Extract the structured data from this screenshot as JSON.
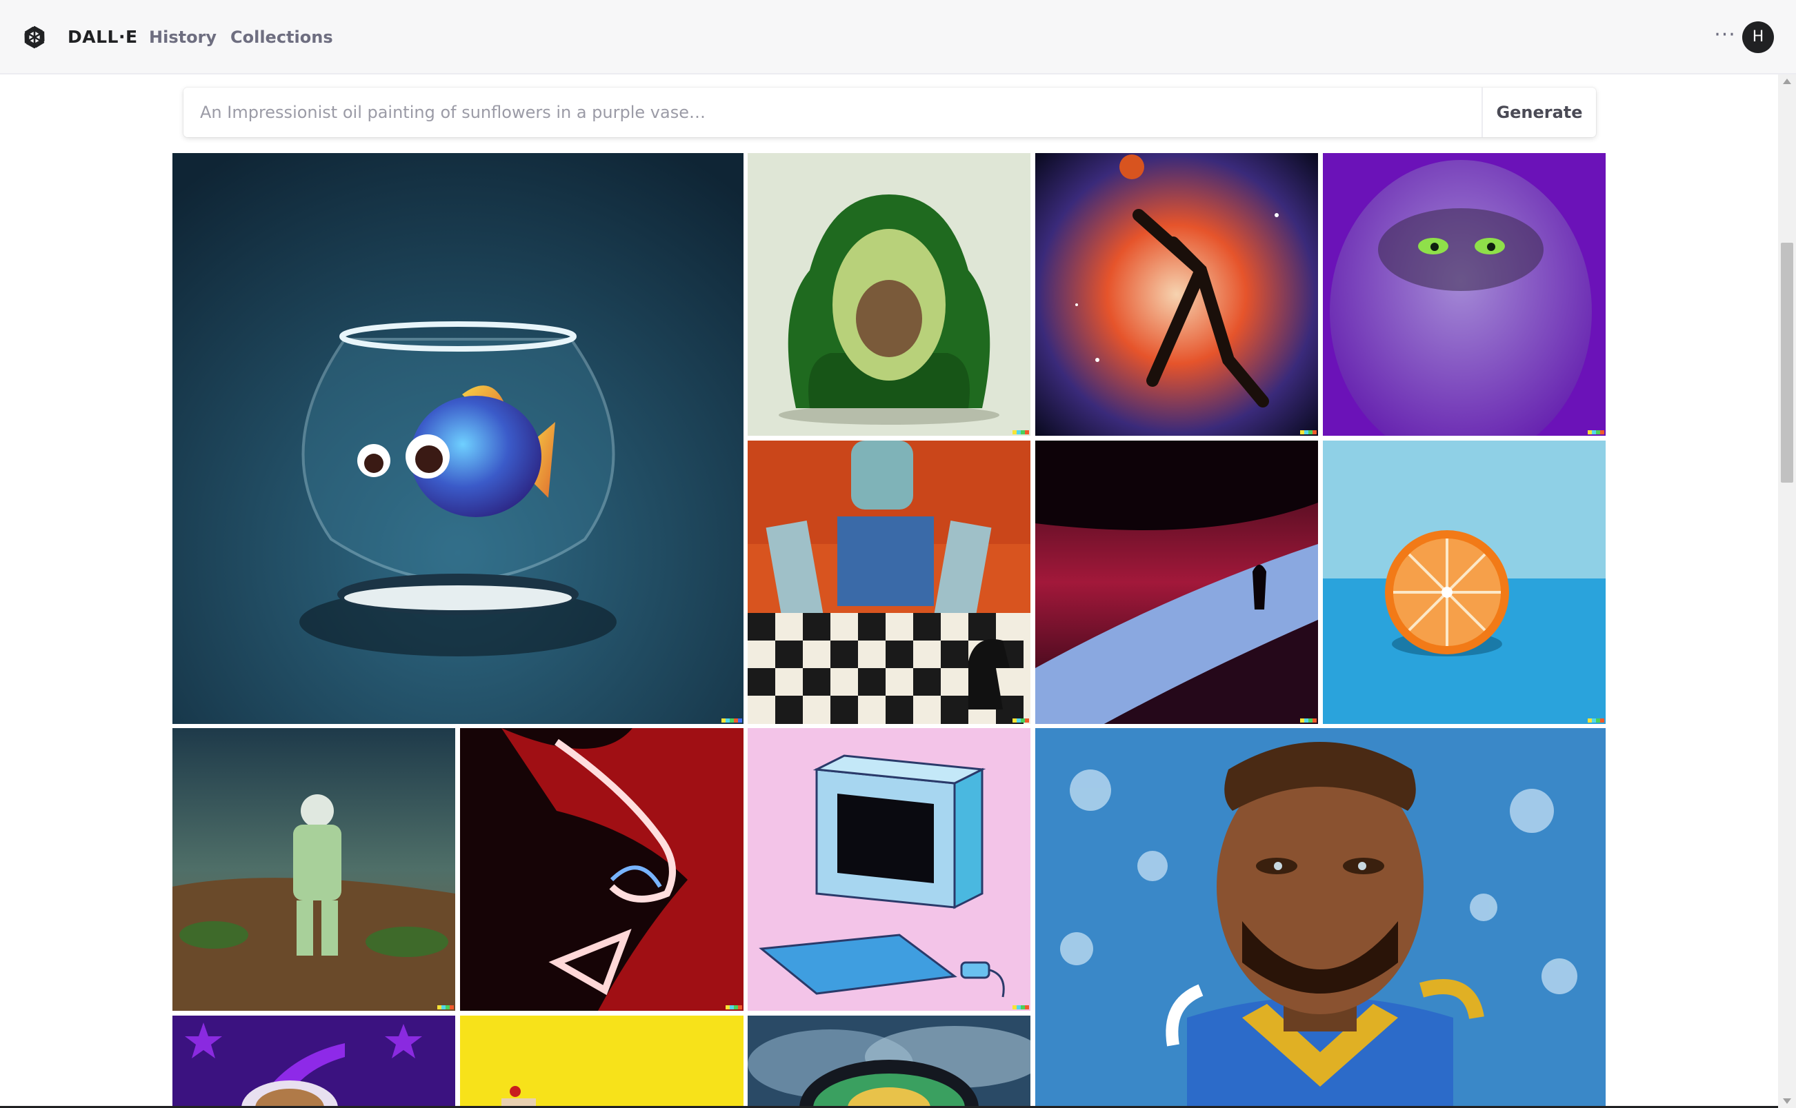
{
  "header": {
    "brand": "DALL·E",
    "nav": [
      "History",
      "Collections"
    ],
    "more_label": "···",
    "avatar_initial": "H"
  },
  "search": {
    "placeholder": "An Impressionist oil painting of sunflowers in a purple vase…",
    "value": "",
    "button_label": "Generate"
  },
  "gallery": [
    {
      "name": "fish-bowl-image",
      "subject": "3D cartoon fish in a glass bowl"
    },
    {
      "name": "avocado-chair-image",
      "subject": "green velvet avocado armchair"
    },
    {
      "name": "space-basketball-image",
      "subject": "painting of basketball player dunking in nebula"
    },
    {
      "name": "purple-monster-image",
      "subject": "fluffy purple monster"
    },
    {
      "name": "robot-chess-image",
      "subject": "painting of robot playing chess"
    },
    {
      "name": "desert-silhouette-image",
      "subject": "figure on neon dunes at night"
    },
    {
      "name": "orange-half-image",
      "subject": "halved orange on blue surface"
    },
    {
      "name": "astronaut-desert-image",
      "subject": "astronaut walking in desert"
    },
    {
      "name": "neon-face-image",
      "subject": "neon red face profile"
    },
    {
      "name": "retro-computer-image",
      "subject": "illustration of retro computer on pink"
    },
    {
      "name": "football-player-portrait-image",
      "subject": "painted portrait of football player"
    },
    {
      "name": "space-monkey-image",
      "subject": "cartoon monkey in space"
    },
    {
      "name": "yellow-scene-image",
      "subject": "yellow background scene"
    },
    {
      "name": "cosmic-bowl-image",
      "subject": "bowl with cosmic clouds"
    }
  ],
  "colors": {
    "header_bg": "#f7f7f8",
    "brand_text": "#202123",
    "nav_text": "#6e6e80",
    "avatar_bg": "#202123"
  }
}
